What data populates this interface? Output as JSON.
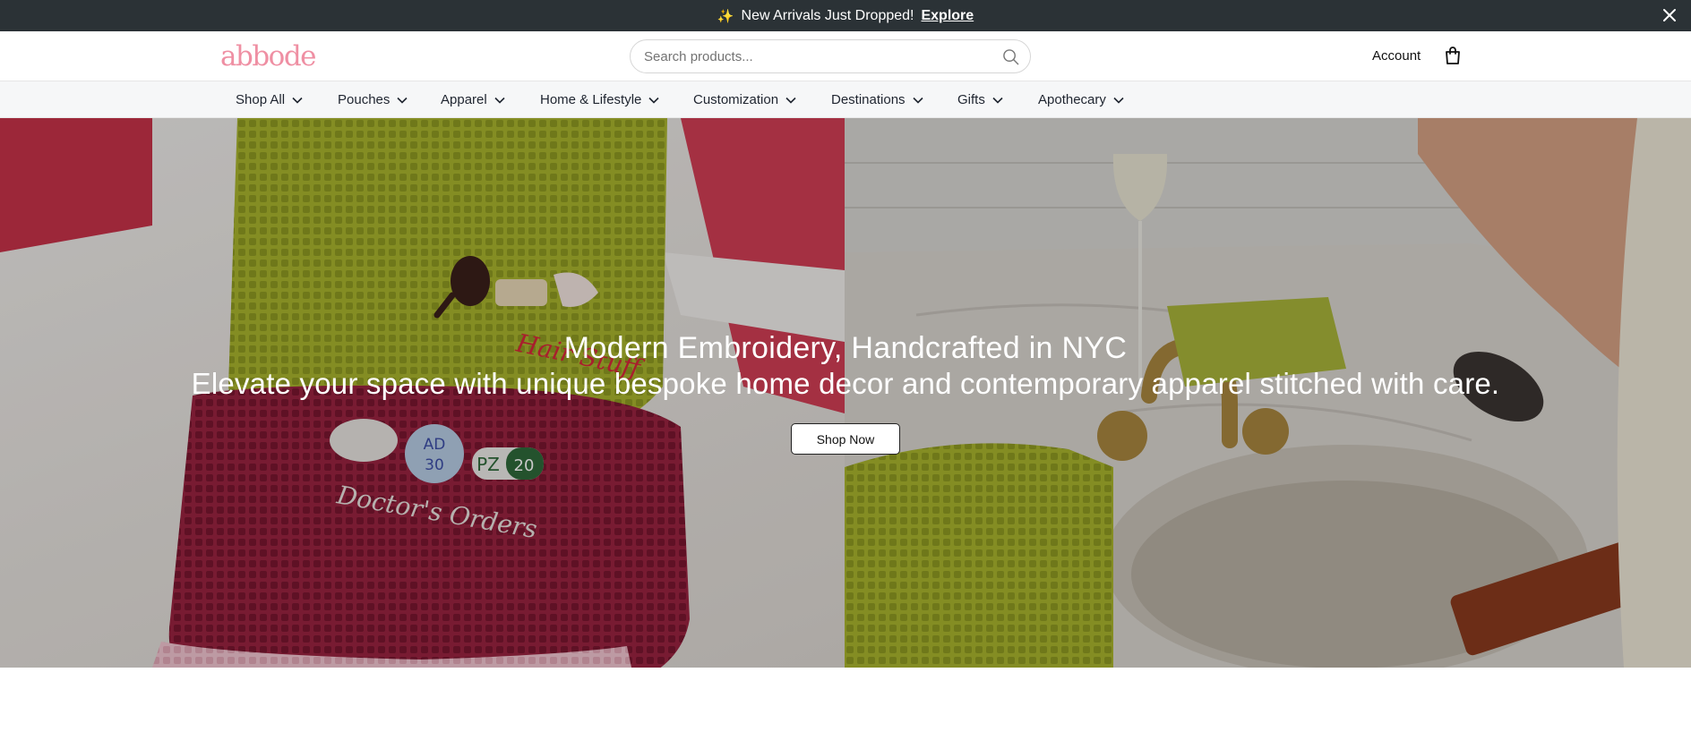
{
  "announcement": {
    "text": "New Arrivals Just Dropped!",
    "link": "Explore",
    "icon": "sparkles-icon"
  },
  "header": {
    "logo": "abbode",
    "search_placeholder": "Search products...",
    "account": "Account"
  },
  "nav": {
    "items": [
      {
        "label": "Shop All"
      },
      {
        "label": "Pouches"
      },
      {
        "label": "Apparel"
      },
      {
        "label": "Home & Lifestyle"
      },
      {
        "label": "Customization"
      },
      {
        "label": "Destinations"
      },
      {
        "label": "Gifts"
      },
      {
        "label": "Apothecary"
      }
    ]
  },
  "hero": {
    "title": "Modern Embroidery, Handcrafted in NYC",
    "subtitle": "Elevate your space with unique bespoke home decor and contemporary apparel stitched with care.",
    "cta": "Shop Now",
    "embroidery_text": [
      "Hair Stuff",
      "AD",
      "30",
      "PZ",
      "20",
      "Doctor's Orders"
    ]
  },
  "colors": {
    "announce_bg": "#2b3236",
    "logo_pink": "#ef8fa3",
    "nav_bg": "#f6f7f8",
    "pouch_green": "#a9b52e",
    "pouch_burgundy": "#8c1d36",
    "pouch_pink": "#f2c1cd"
  }
}
